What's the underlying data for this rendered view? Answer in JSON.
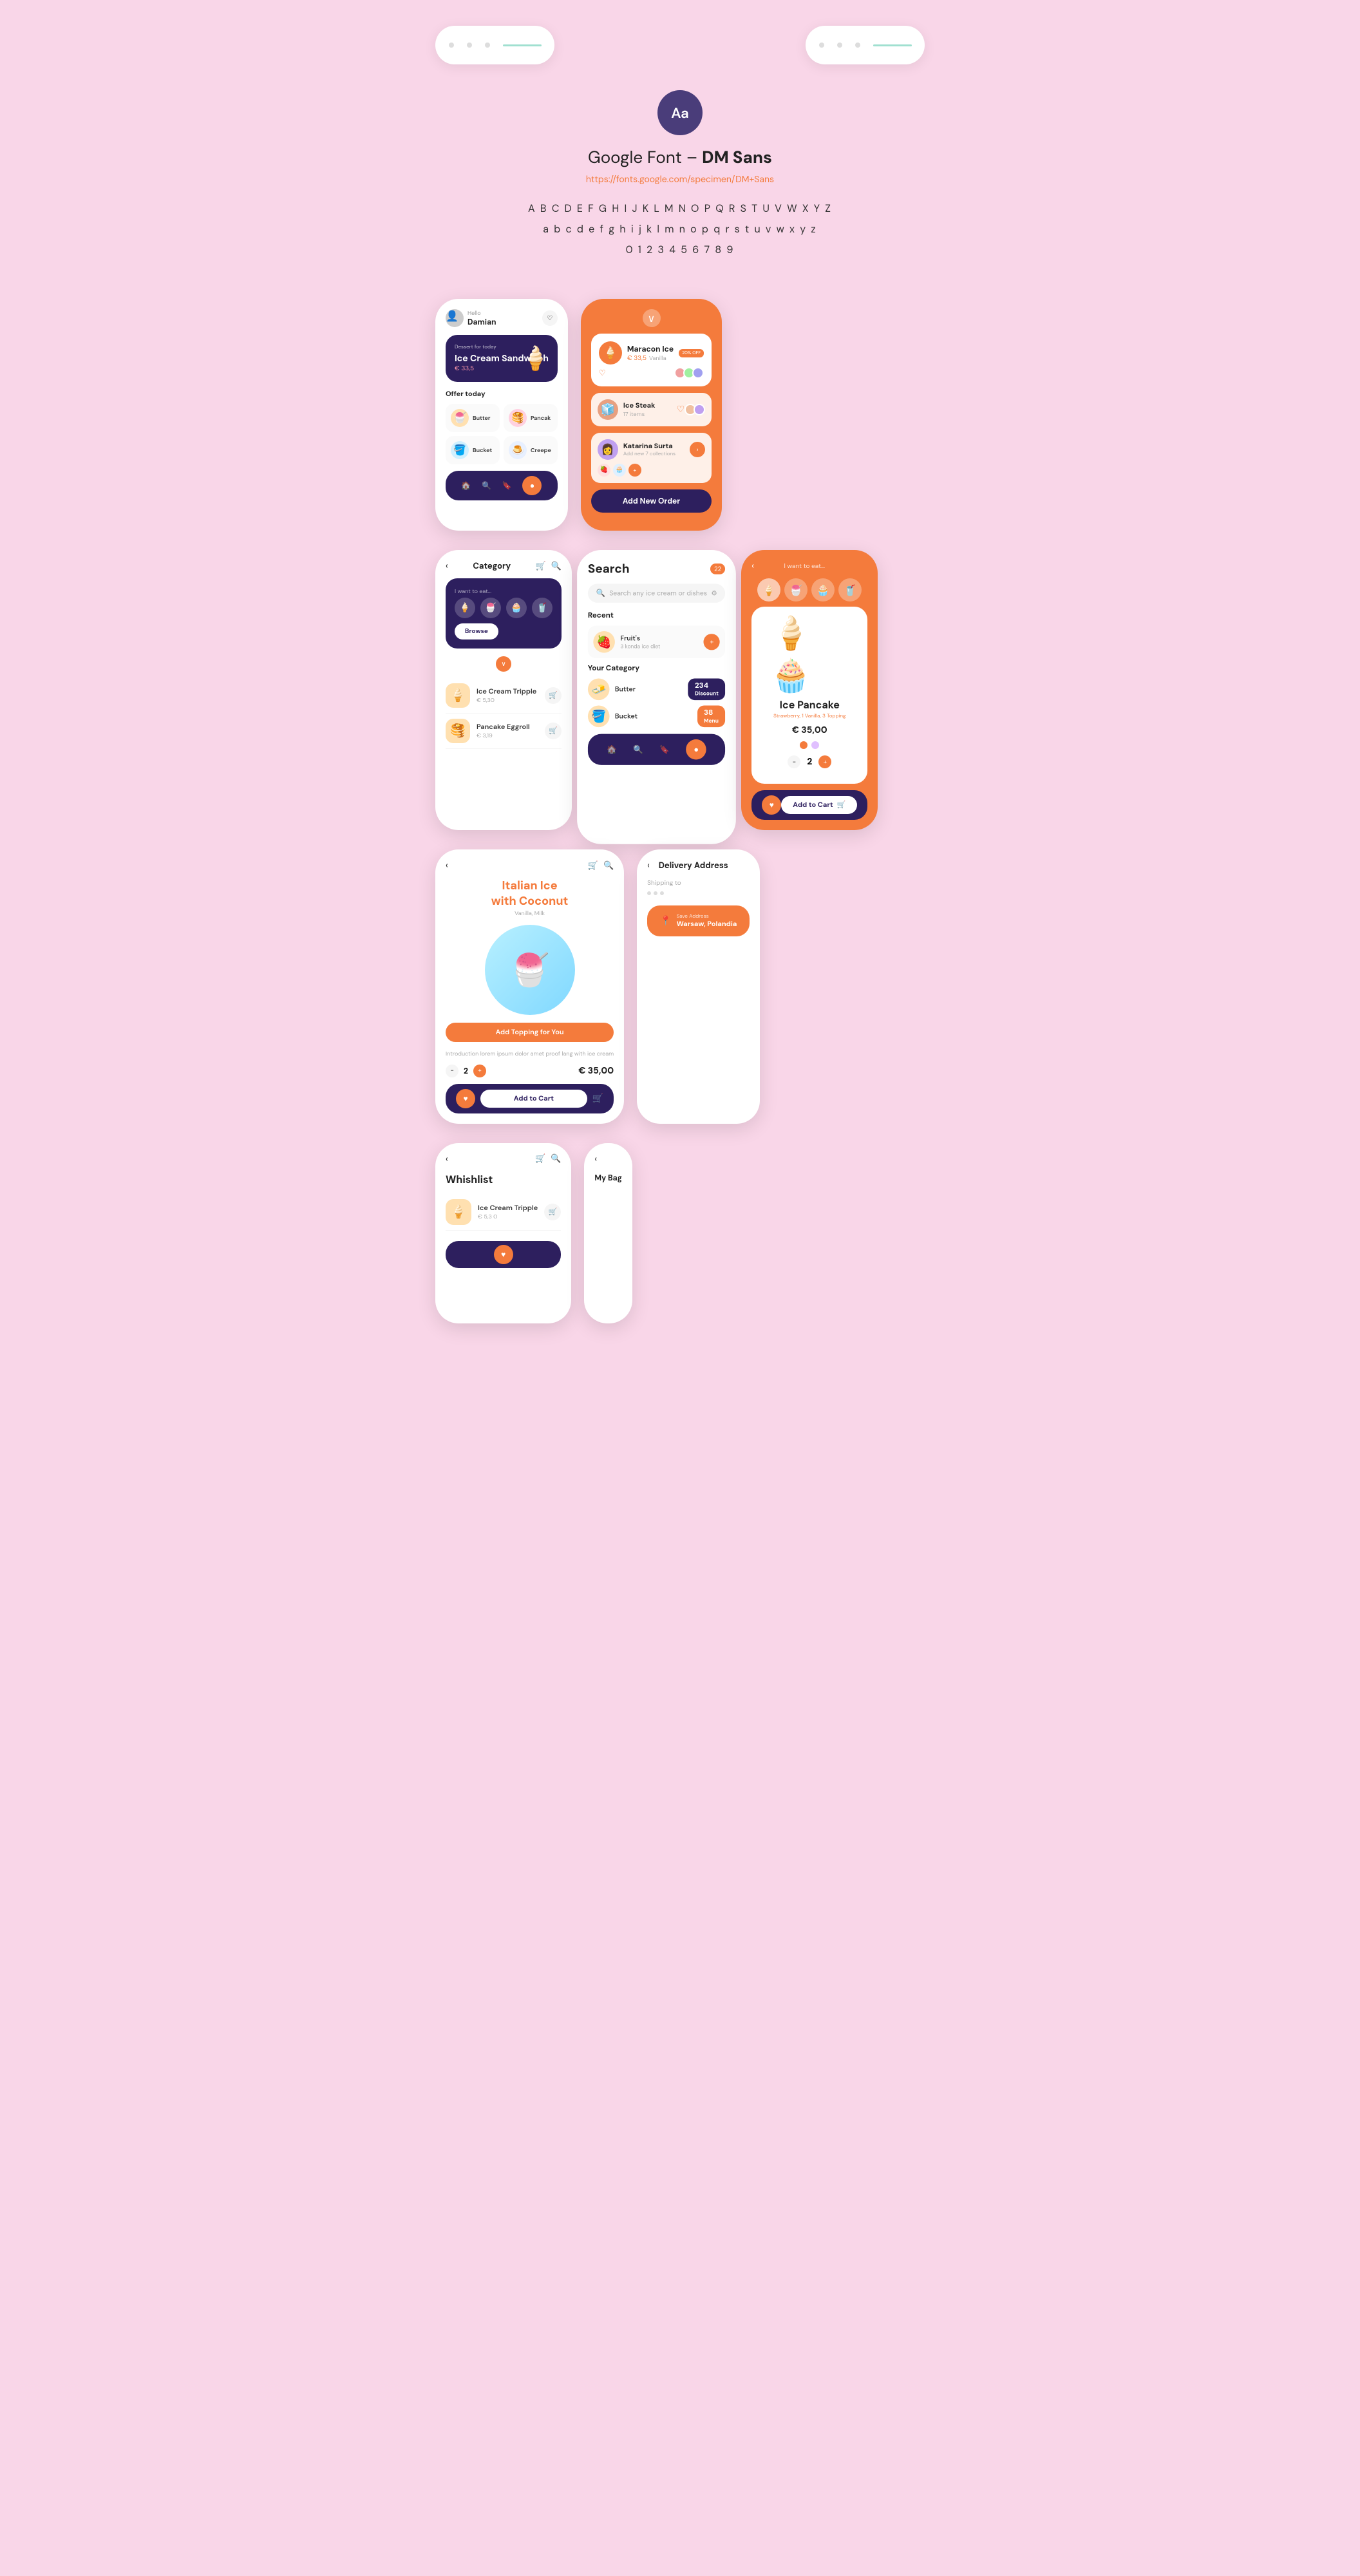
{
  "font": {
    "badge_text": "Aa",
    "title": "Google Font – ",
    "title_bold": "DM Sans",
    "link": "https://fonts.google.com/specimen/DM+Sans",
    "uppercase": "A B C D E F G H I J K L M N O P Q R S T U V W X Y Z",
    "lowercase": "a b c d e f g h i j k l m n o p q r s t u v w x y z",
    "numbers": "0 1 2 3 4 5 6 7 8 9"
  },
  "phone1": {
    "hello": "Hello",
    "user": "Damian",
    "banner_label": "Dessert for today",
    "banner_title": "Ice Cream Sandwitch",
    "banner_price": "€ 33,5",
    "offer_title": "Offer today",
    "items": [
      {
        "name": "Butter"
      },
      {
        "name": "Pancak"
      },
      {
        "name": "Bucket"
      },
      {
        "name": "Creepe"
      }
    ]
  },
  "phone2": {
    "title": "Search",
    "search_placeholder": "Search any ice cream or dishes",
    "recent_title": "Recent",
    "recent_item": "Fruit's",
    "recent_sub": "3 konda ice diet",
    "category_title": "Your Category",
    "cat1_name": "Butter",
    "cat1_count": "234",
    "cat1_label": "Discount",
    "cat2_name": "Bucket",
    "cat2_count": "38",
    "cat2_label": "Menu"
  },
  "phone3": {
    "marakon_name": "Maracon Ice",
    "marakon_price": "€ 33,5",
    "marakon_sub": "Vanilla",
    "marakon_off": "20% OFF",
    "ice_steak_name": "Ice Steak",
    "ice_steak_count": "17 items",
    "katarina_name": "Katarina Surta",
    "katarina_sub": "Add new 7 collections",
    "add_btn": "Add New Order"
  },
  "phone4": {
    "title": "Category",
    "sub_label": "I want to eat...",
    "browse_btn": "Browse",
    "item1_name": "Ice Cream Tripple",
    "item1_price": "€ 5,30",
    "item2_name": "Pancake Eggroll",
    "item2_price": "€ 3,19"
  },
  "phone5": {
    "title_line1": "Italian Ice",
    "title_line2": "with Coconut",
    "sub": "Vanilla, Milk",
    "topping_btn": "Add Topping for You",
    "description": "Introduction lorem ipsum dolor amet proof lang with ice cream",
    "qty": "2",
    "price": "€ 35,00",
    "add_btn": "Add to Cart"
  },
  "phone6": {
    "eat_label": "I want to eat...",
    "product_name": "Ice Pancake",
    "ingredients": "Strawberry, 1 Vanilla, 3 Topping",
    "price": "€ 35,00",
    "qty": "2",
    "add_btn": "Add to Cart"
  },
  "phone7": {
    "title": "Whishlist",
    "item1_name": "Ice Cream Tripple",
    "item1_price": "€ 5,3 0"
  },
  "phone8": {
    "title": "Delivery Address",
    "ship_label": "Shipping to",
    "address": "Warsaw, Polandia",
    "save_label": "Save Address"
  },
  "colors": {
    "pink_bg": "#f9d6e8",
    "orange": "#f47b3c",
    "purple": "#2d1f5e",
    "white": "#ffffff"
  }
}
